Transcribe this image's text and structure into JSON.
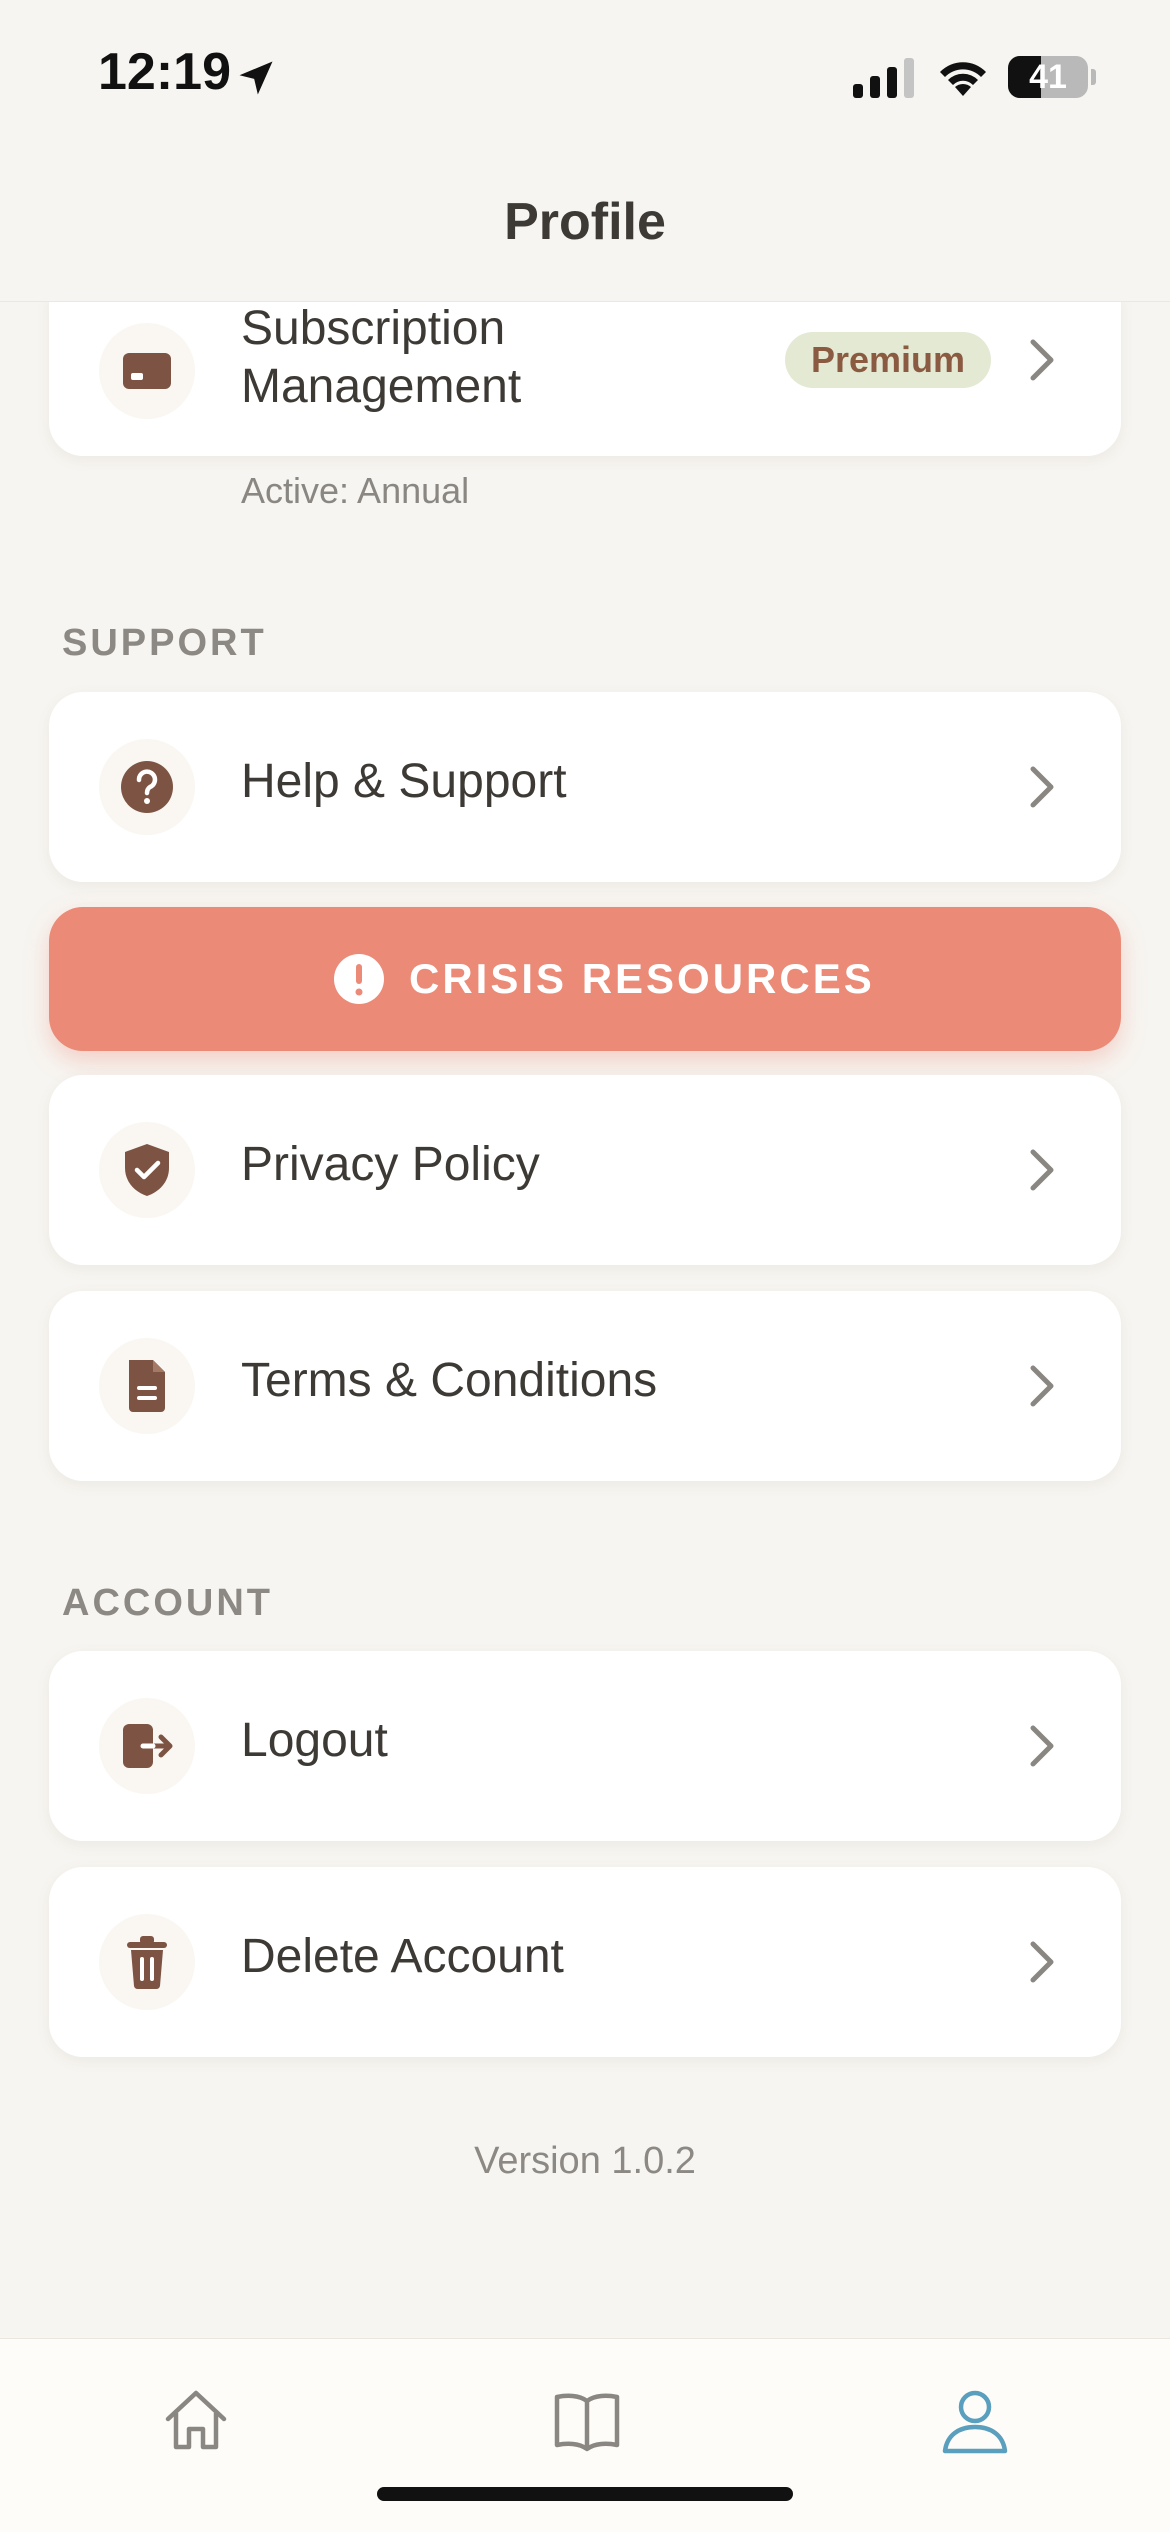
{
  "status_bar": {
    "time": "12:19",
    "battery_level": "41",
    "battery_fraction": 0.41
  },
  "header": {
    "title": "Profile"
  },
  "subscription": {
    "label": "Subscription Management",
    "badge": "Premium",
    "note": "Active: Annual",
    "icon": "credit-card-icon"
  },
  "sections": {
    "support_label": "SUPPORT",
    "account_label": "ACCOUNT"
  },
  "support_items": [
    {
      "label": "Help & Support",
      "icon": "question-circle-icon"
    },
    {
      "label": "Privacy Policy",
      "icon": "shield-check-icon"
    },
    {
      "label": "Terms & Conditions",
      "icon": "document-icon"
    }
  ],
  "crisis": {
    "label": "CRISIS RESOURCES",
    "icon": "alert-circle-icon"
  },
  "account_items": [
    {
      "label": "Logout",
      "icon": "logout-icon"
    },
    {
      "label": "Delete Account",
      "icon": "trash-icon"
    }
  ],
  "version": "Version 1.0.2",
  "tab_bar": {
    "tabs": [
      {
        "name": "home",
        "icon": "home-icon",
        "active": false
      },
      {
        "name": "library",
        "icon": "book-icon",
        "active": false
      },
      {
        "name": "profile",
        "icon": "user-icon",
        "active": true
      }
    ]
  },
  "colors": {
    "background": "#f7f5f1",
    "icon_brown": "#7d5443",
    "crisis": "#ea8a77",
    "badge_bg": "#e3e9d3",
    "badge_text": "#8a5b41",
    "tab_active": "#5a9fbd",
    "tab_inactive": "#8a8782"
  }
}
